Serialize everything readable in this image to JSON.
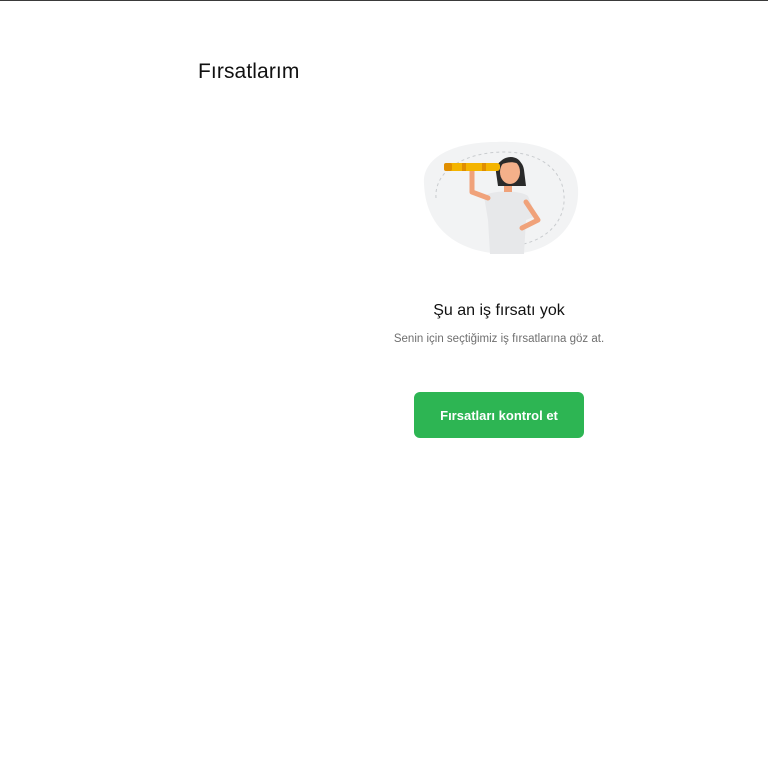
{
  "page": {
    "title": "Fırsatlarım"
  },
  "empty_state": {
    "illustration_icon": "woman-with-telescope-illustration",
    "title": "Şu an iş fırsatı yok",
    "subtitle": "Senin için seçtiğimiz iş fırsatlarına göz at.",
    "button_label": "Fırsatları kontrol et"
  },
  "colors": {
    "accent": "#2db553",
    "title_text": "#111111",
    "subtitle_text": "#6f6f6f",
    "illustration_blob": "#f2f3f4",
    "telescope": "#f4b400"
  }
}
